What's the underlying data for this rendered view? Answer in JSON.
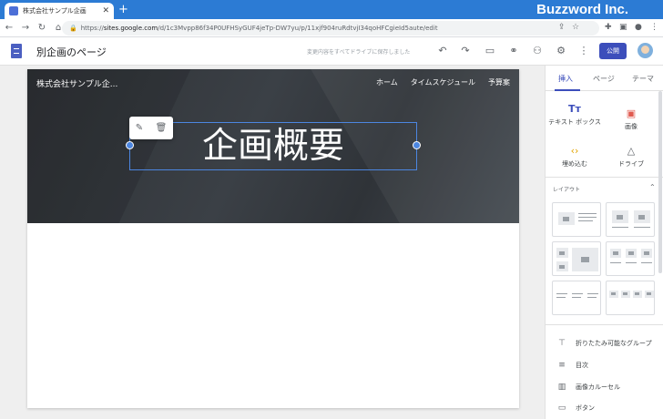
{
  "browser": {
    "tab_title": "株式会社サンプル企画",
    "brand": "Buzzword Inc.",
    "url_prefix": "https://",
    "url_host": "sites.google.com",
    "url_path": "/d/1c3Mvpp86f34P0UFHSyGUF4jeTp-DW7yu/p/11xjf904ruRdtvjI34qoHFCgieId5aute/edit"
  },
  "app": {
    "doc_title": "別企画のページ",
    "saved_status": "変更内容をすべてドライブに保存しました",
    "publish_label": "公開"
  },
  "site": {
    "name": "株式会社サンプル企...",
    "nav": [
      "ホーム",
      "タイムスケジュール",
      "予算案"
    ],
    "hero_title": "企画概要"
  },
  "panel": {
    "tabs": [
      "挿入",
      "ページ",
      "テーマ"
    ],
    "insert_items": [
      {
        "label": "テキスト ボックス",
        "icon": "text-box-icon"
      },
      {
        "label": "画像",
        "icon": "image-icon"
      },
      {
        "label": "埋め込む",
        "icon": "embed-icon"
      },
      {
        "label": "ドライブ",
        "icon": "drive-icon"
      }
    ],
    "layout_header": "レイアウト",
    "components": [
      {
        "label": "折りたたみ可能なグループ",
        "icon": "collapsible-icon"
      },
      {
        "label": "目次",
        "icon": "toc-icon"
      },
      {
        "label": "画像カルーセル",
        "icon": "carousel-icon"
      },
      {
        "label": "ボタン",
        "icon": "button-icon"
      }
    ]
  },
  "colors": {
    "chrome": "#2c7bd4",
    "accent": "#3c4ebb",
    "selection": "#4c86e0"
  }
}
